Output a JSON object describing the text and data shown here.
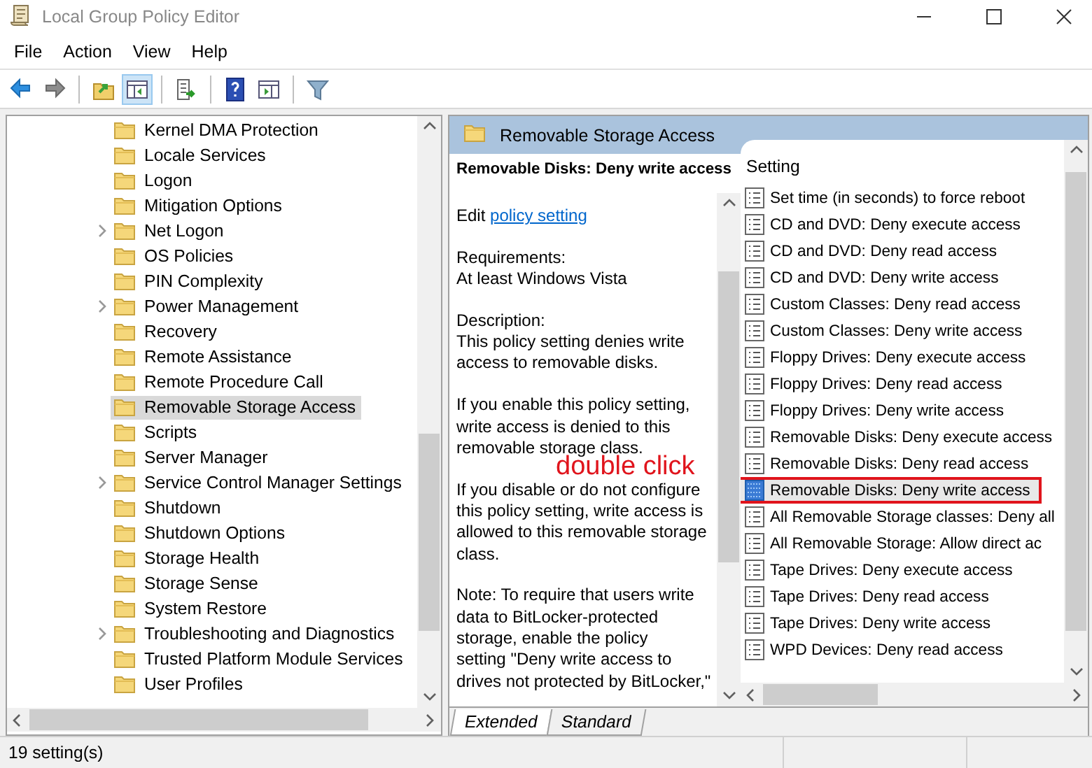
{
  "window": {
    "title": "Local Group Policy Editor"
  },
  "menu": [
    "File",
    "Action",
    "View",
    "Help"
  ],
  "toolbar": [
    {
      "kind": "back",
      "pressed": false
    },
    {
      "kind": "forward",
      "pressed": false
    },
    {
      "kind": "up",
      "pressed": false
    },
    {
      "kind": "tree",
      "pressed": true
    },
    {
      "kind": "export",
      "pressed": false
    },
    {
      "kind": "help",
      "pressed": false
    },
    {
      "kind": "pane",
      "pressed": false
    },
    {
      "kind": "filter",
      "pressed": false
    }
  ],
  "tree": {
    "items": [
      {
        "label": "Kernel DMA Protection",
        "expandable": false,
        "selected": false
      },
      {
        "label": "Locale Services",
        "expandable": false,
        "selected": false
      },
      {
        "label": "Logon",
        "expandable": false,
        "selected": false
      },
      {
        "label": "Mitigation Options",
        "expandable": false,
        "selected": false
      },
      {
        "label": "Net Logon",
        "expandable": true,
        "selected": false
      },
      {
        "label": "OS Policies",
        "expandable": false,
        "selected": false
      },
      {
        "label": "PIN Complexity",
        "expandable": false,
        "selected": false
      },
      {
        "label": "Power Management",
        "expandable": true,
        "selected": false
      },
      {
        "label": "Recovery",
        "expandable": false,
        "selected": false
      },
      {
        "label": "Remote Assistance",
        "expandable": false,
        "selected": false
      },
      {
        "label": "Remote Procedure Call",
        "expandable": false,
        "selected": false
      },
      {
        "label": "Removable Storage Access",
        "expandable": false,
        "selected": true
      },
      {
        "label": "Scripts",
        "expandable": false,
        "selected": false
      },
      {
        "label": "Server Manager",
        "expandable": false,
        "selected": false
      },
      {
        "label": "Service Control Manager Settings",
        "expandable": true,
        "selected": false
      },
      {
        "label": "Shutdown",
        "expandable": false,
        "selected": false
      },
      {
        "label": "Shutdown Options",
        "expandable": false,
        "selected": false
      },
      {
        "label": "Storage Health",
        "expandable": false,
        "selected": false
      },
      {
        "label": "Storage Sense",
        "expandable": false,
        "selected": false
      },
      {
        "label": "System Restore",
        "expandable": false,
        "selected": false
      },
      {
        "label": "Troubleshooting and Diagnostics",
        "expandable": true,
        "selected": false
      },
      {
        "label": "Trusted Platform Module Services",
        "expandable": false,
        "selected": false
      },
      {
        "label": "User Profiles",
        "expandable": false,
        "selected": false
      }
    ]
  },
  "header": {
    "title": "Removable Storage Access"
  },
  "description": {
    "title": "Removable Disks: Deny write access",
    "edit_prefix": "Edit",
    "edit_link": "policy setting",
    "paragraphs": [
      "Requirements:\nAt least Windows Vista",
      "Description:\nThis policy setting denies write access to removable disks.",
      "If you enable this policy setting, write access is denied to this removable storage class.",
      "If you disable or do not configure this policy setting, write access is allowed to this removable storage class.",
      "Note: To require that users write\ndata to BitLocker-protected\nstorage, enable the policy\nsetting \"Deny write access to\ndrives not protected by BitLocker,\""
    ]
  },
  "settings": {
    "column": "Setting",
    "rows": [
      {
        "label": "Set time (in seconds) to force reboot",
        "selected": false,
        "annotated": false
      },
      {
        "label": "CD and DVD: Deny execute access",
        "selected": false,
        "annotated": false
      },
      {
        "label": "CD and DVD: Deny read access",
        "selected": false,
        "annotated": false
      },
      {
        "label": "CD and DVD: Deny write access",
        "selected": false,
        "annotated": false
      },
      {
        "label": "Custom Classes: Deny read access",
        "selected": false,
        "annotated": false
      },
      {
        "label": "Custom Classes: Deny write access",
        "selected": false,
        "annotated": false
      },
      {
        "label": "Floppy Drives: Deny execute access",
        "selected": false,
        "annotated": false
      },
      {
        "label": "Floppy Drives: Deny read access",
        "selected": false,
        "annotated": false
      },
      {
        "label": "Floppy Drives: Deny write access",
        "selected": false,
        "annotated": false
      },
      {
        "label": "Removable Disks: Deny execute access",
        "selected": false,
        "annotated": false
      },
      {
        "label": "Removable Disks: Deny read access",
        "selected": false,
        "annotated": false
      },
      {
        "label": "Removable Disks: Deny write access",
        "selected": true,
        "annotated": true
      },
      {
        "label": "All Removable Storage classes: Deny all",
        "selected": false,
        "annotated": false
      },
      {
        "label": "All Removable Storage: Allow direct ac",
        "selected": false,
        "annotated": false
      },
      {
        "label": "Tape Drives: Deny execute access",
        "selected": false,
        "annotated": false
      },
      {
        "label": "Tape Drives: Deny read access",
        "selected": false,
        "annotated": false
      },
      {
        "label": "Tape Drives: Deny write access",
        "selected": false,
        "annotated": false
      },
      {
        "label": "WPD Devices: Deny read access",
        "selected": false,
        "annotated": false
      }
    ]
  },
  "annotation": {
    "text": "double click"
  },
  "tabs": [
    {
      "label": "Extended",
      "selected": true
    },
    {
      "label": "Standard",
      "selected": false
    }
  ],
  "status_bar": {
    "text": "19 setting(s)"
  }
}
